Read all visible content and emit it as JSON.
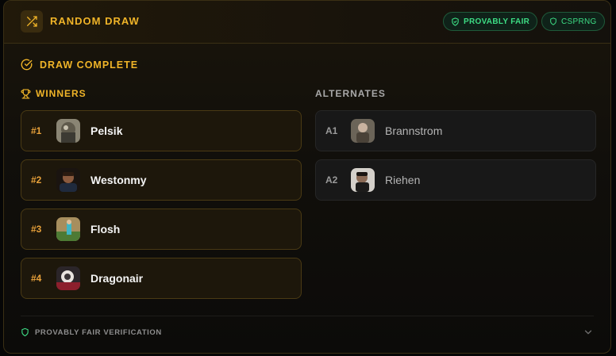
{
  "header": {
    "title": "RANDOM DRAW",
    "badges": {
      "provably_fair": "PROVABLY FAIR",
      "csprng": "CSPRNG"
    }
  },
  "status": {
    "label": "DRAW COMPLETE"
  },
  "winners": {
    "label": "WINNERS",
    "items": [
      {
        "rank": "#1",
        "name": "Pelsik"
      },
      {
        "rank": "#2",
        "name": "Westonmy"
      },
      {
        "rank": "#3",
        "name": "Flosh"
      },
      {
        "rank": "#4",
        "name": "Dragonair"
      }
    ]
  },
  "alternates": {
    "label": "ALTERNATES",
    "items": [
      {
        "rank": "A1",
        "name": "Brannstrom"
      },
      {
        "rank": "A2",
        "name": "Riehen"
      }
    ]
  },
  "footer": {
    "label": "PROVABLY FAIR VERIFICATION"
  },
  "colors": {
    "accent": "#f0b428",
    "success": "#3ddc84",
    "background": "#060606"
  },
  "icons": {
    "header": "shuffle-icon",
    "status": "check-circle-icon",
    "winners": "trophy-icon",
    "badges": "shield-icon",
    "footer": "shield-icon",
    "expand": "chevron-down-icon"
  }
}
